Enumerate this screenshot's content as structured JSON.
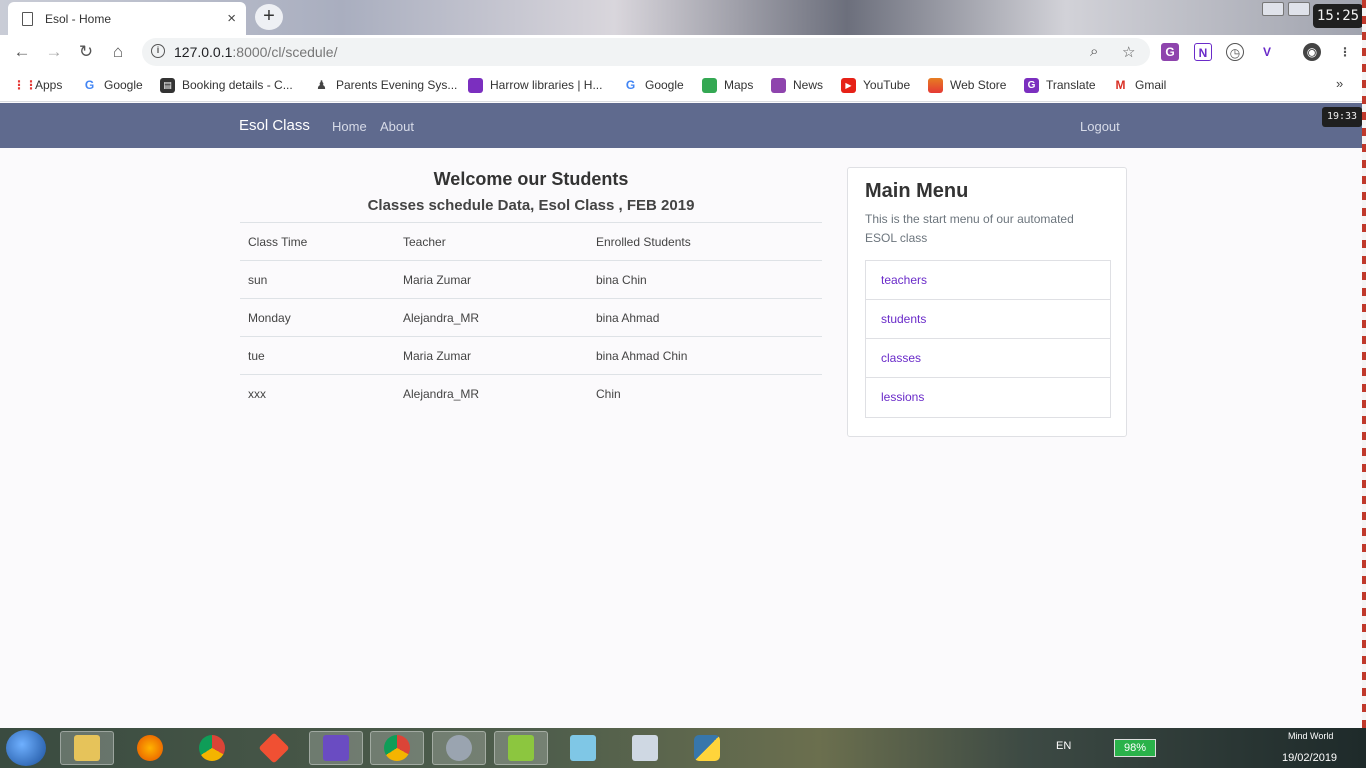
{
  "browser": {
    "tab_title": "Esol - Home",
    "tab_close": "×",
    "new_tab": "+",
    "url_host": "127.0.0.1",
    "url_rest": ":8000/cl/scedule/",
    "clock": "15:25"
  },
  "bookmarks": [
    {
      "label": "Apps",
      "icon": "apps-grid-icon",
      "color": "#e53935"
    },
    {
      "label": "Google",
      "icon": "google-icon",
      "color": "#4285f4"
    },
    {
      "label": "Booking details - C...",
      "icon": "booking-icon",
      "color": "#333333"
    },
    {
      "label": "Parents Evening Sys...",
      "icon": "person-icon",
      "color": "#444444"
    },
    {
      "label": "Harrow libraries | H...",
      "icon": "library-icon",
      "color": "#7b2fbf"
    },
    {
      "label": "Google",
      "icon": "google-icon",
      "color": "#4285f4"
    },
    {
      "label": "Maps",
      "icon": "maps-icon",
      "color": "#34a853"
    },
    {
      "label": "News",
      "icon": "news-icon",
      "color": "#8e44ad"
    },
    {
      "label": "YouTube",
      "icon": "youtube-icon",
      "color": "#e62117"
    },
    {
      "label": "Web Store",
      "icon": "webstore-icon",
      "color": "#e67e22"
    },
    {
      "label": "Translate",
      "icon": "translate-icon",
      "color": "#7b2fbf"
    },
    {
      "label": "Gmail",
      "icon": "gmail-icon",
      "color": "#d93025"
    }
  ],
  "bookmarks_more": "»",
  "appnav": {
    "brand": "Esol Class",
    "home": "Home",
    "about": "About",
    "logout": "Logout",
    "overlay_time": "19:33"
  },
  "main": {
    "title": "Welcome our Students",
    "subtitle": "Classes schedule Data, Esol Class , FEB 2019",
    "columns": [
      "Class Time",
      "Teacher",
      "Enrolled Students"
    ],
    "rows": [
      [
        "sun",
        "Maria Zumar",
        "bina Chin"
      ],
      [
        "Monday",
        "Alejandra_MR",
        "bina Ahmad"
      ],
      [
        "tue",
        "Maria Zumar",
        "bina Ahmad Chin"
      ],
      [
        "xxx",
        "Alejandra_MR",
        "Chin"
      ]
    ]
  },
  "menu": {
    "title": "Main Menu",
    "description": "This is the start menu of our automated ESOL class",
    "items": [
      "teachers",
      "students",
      "classes",
      "lessions"
    ]
  },
  "taskbar": {
    "lang": "EN",
    "battery": "98%",
    "date": "19/02/2019",
    "watermark": "Mind   World"
  },
  "colors": {
    "navbar": "#5f6a8e",
    "menu_link": "#6a2bc9"
  }
}
